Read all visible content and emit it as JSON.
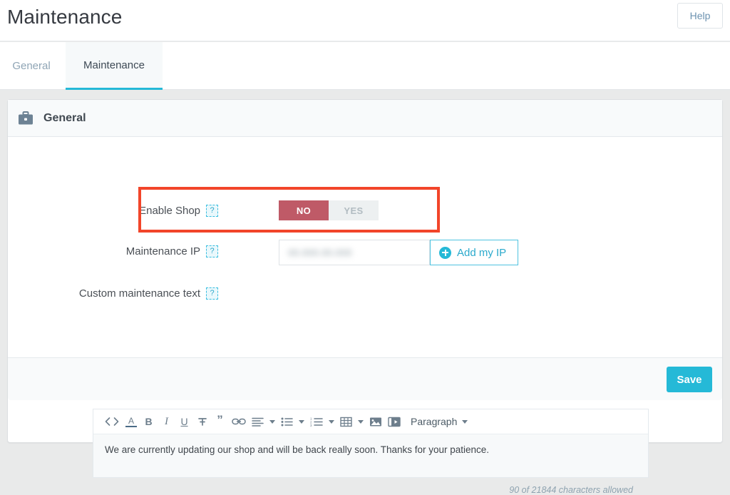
{
  "header": {
    "title": "Maintenance",
    "help_label": "Help"
  },
  "tabs": [
    {
      "label": "General",
      "active": false
    },
    {
      "label": "Maintenance",
      "active": true
    }
  ],
  "panel": {
    "icon": "briefcase-icon",
    "title": "General",
    "save_label": "Save"
  },
  "form": {
    "enable_shop": {
      "label": "Enable Shop",
      "help": "?",
      "options": [
        {
          "label": "NO",
          "selected": true
        },
        {
          "label": "YES",
          "selected": false
        }
      ]
    },
    "maintenance_ip": {
      "label": "Maintenance IP",
      "help": "?",
      "value": "00.000.00.000",
      "placeholder": "",
      "add_button_label": "Add my IP"
    },
    "custom_text": {
      "label": "Custom maintenance text",
      "help": "?",
      "content": "We are currently updating our shop and will be back really soon. Thanks for your patience.",
      "char_count": "90 of 21844 characters allowed",
      "toolbar": [
        {
          "name": "source-code-icon",
          "glyph": "<>"
        },
        {
          "name": "text-color-icon",
          "glyph": "A"
        },
        {
          "name": "bold-icon",
          "glyph": "B"
        },
        {
          "name": "italic-icon",
          "glyph": "I"
        },
        {
          "name": "underline-icon",
          "glyph": "U"
        },
        {
          "name": "strikethrough-icon",
          "glyph": "S"
        },
        {
          "name": "blockquote-icon",
          "glyph": "”"
        },
        {
          "name": "link-icon",
          "glyph": "link"
        },
        {
          "name": "align-icon",
          "glyph": "align"
        },
        {
          "name": "unordered-list-icon",
          "glyph": "ul"
        },
        {
          "name": "ordered-list-icon",
          "glyph": "ol"
        },
        {
          "name": "table-icon",
          "glyph": "table"
        },
        {
          "name": "image-icon",
          "glyph": "image"
        },
        {
          "name": "video-icon",
          "glyph": "video"
        }
      ],
      "format_select": "Paragraph"
    }
  },
  "annotation": {
    "name": "red-highlight-box",
    "color": "#f2452a"
  },
  "colors": {
    "accent": "#25b9d7",
    "toggle_on": "#bf5a67",
    "toggle_off": "#edf0f1",
    "help_chip": "#3bbfe0",
    "highlight": "#f2452a"
  }
}
